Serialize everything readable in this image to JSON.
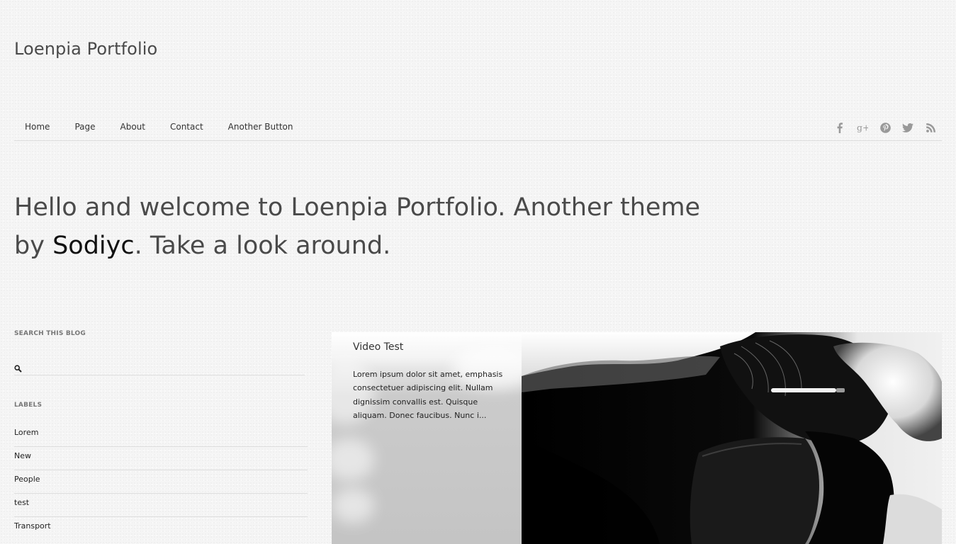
{
  "site": {
    "title": "Loenpia Portfolio"
  },
  "nav": {
    "items": [
      {
        "label": "Home"
      },
      {
        "label": "Page"
      },
      {
        "label": "About"
      },
      {
        "label": "Contact"
      },
      {
        "label": "Another Button"
      }
    ]
  },
  "social": {
    "icons": [
      "facebook-icon",
      "google-plus-icon",
      "pinterest-icon",
      "twitter-icon",
      "rss-icon"
    ],
    "google_plus_glyph": "g+",
    "icon_color": "#999999"
  },
  "welcome": {
    "text_before": "Hello and welcome to Loenpia Portfolio. Another theme by ",
    "author": "Sodiyc",
    "text_after": ". Take a look around."
  },
  "sidebar": {
    "search": {
      "title": "SEARCH THIS BLOG",
      "value": "",
      "placeholder": ""
    },
    "labels": {
      "title": "LABELS",
      "items": [
        "Lorem",
        "New",
        "People",
        "test",
        "Transport"
      ]
    }
  },
  "featured": {
    "title": "Video Test",
    "excerpt": "Lorem ipsum dolor sit amet, emphasis consectetuer adipiscing elit. Nullam dignissim convallis est. Quisque aliquam. Donec faucibus. Nunc i..."
  }
}
